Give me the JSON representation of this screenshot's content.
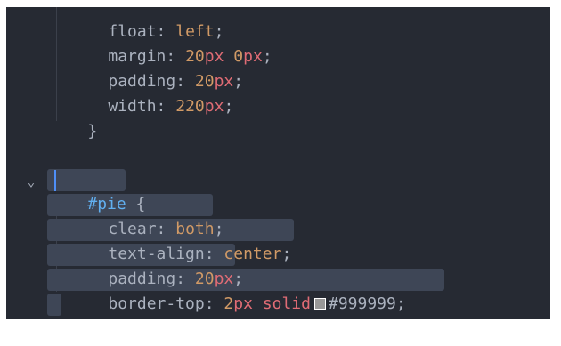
{
  "editor": {
    "fold_icon": "chevron-down-icon",
    "lines": [
      {
        "prop": "float",
        "colon": ":",
        "value": "left",
        "semi": ";"
      },
      {
        "prop": "margin",
        "colon": ":",
        "n1": "20",
        "u1": "px",
        "n2": "0",
        "u2": "px",
        "semi": ";"
      },
      {
        "prop": "padding",
        "colon": ":",
        "n1": "20",
        "u1": "px",
        "semi": ";"
      },
      {
        "prop": "width",
        "colon": ":",
        "n1": "220",
        "u1": "px",
        "semi": ";"
      },
      {
        "brace": "}"
      },
      {
        "hash": "#",
        "selector": "pie",
        "brace": " {"
      },
      {
        "prop": "clear",
        "colon": ":",
        "value": "both",
        "semi": ";"
      },
      {
        "prop": "text-align",
        "colon": ":",
        "value": "center",
        "semi": ";"
      },
      {
        "prop": "padding",
        "colon": ":",
        "n1": "20",
        "u1": "px",
        "semi": ";"
      },
      {
        "prop": "border-top",
        "colon": ":",
        "n1": "2",
        "u1": "px",
        "kw": "solid",
        "color_hex": "#999999",
        "semi": ";"
      },
      {
        "brace": "}"
      }
    ],
    "colors": {
      "background": "#262a33",
      "selection": "#3e4656",
      "property": "#abb2bf",
      "number": "#d19a66",
      "unit": "#e06c75",
      "keyword": "#d19a66",
      "selector": "#61afef",
      "swatch": "#999999"
    }
  }
}
